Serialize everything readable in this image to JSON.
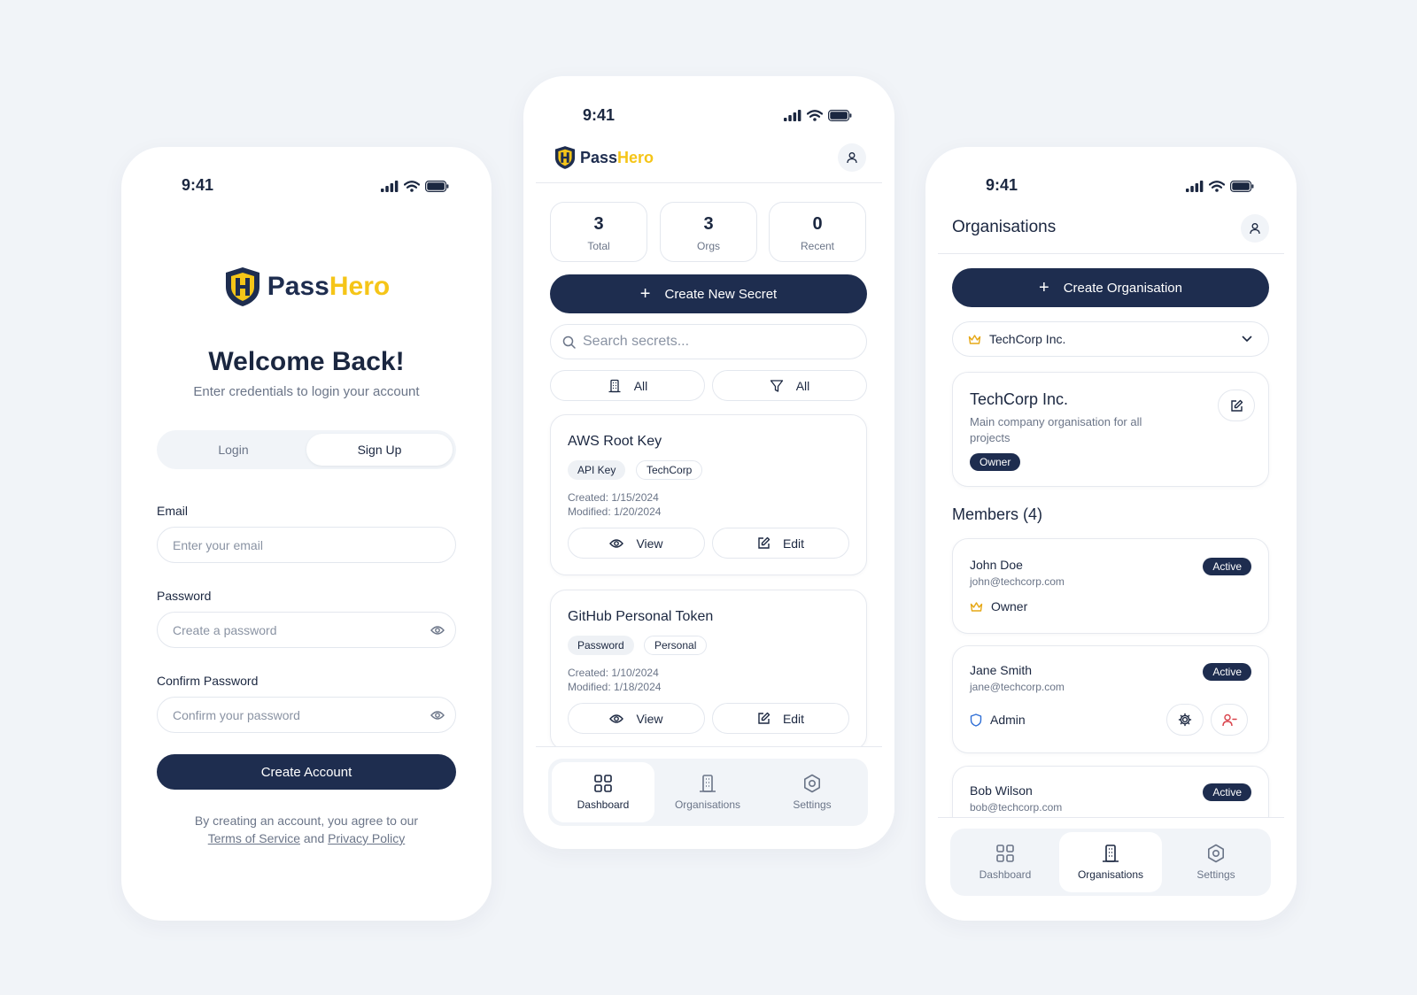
{
  "status_time": "9:41",
  "brand": {
    "pass": "Pass",
    "hero": "Hero"
  },
  "colors": {
    "navy": "#1e2d4f",
    "gold": "#f5c518",
    "muted": "#6b7588",
    "background": "#f1f4f8"
  },
  "login": {
    "heading": "Welcome Back!",
    "subheading": "Enter credentials to login your account",
    "tabs": [
      {
        "label": "Login",
        "active": false
      },
      {
        "label": "Sign Up",
        "active": true
      }
    ],
    "email": {
      "label": "Email",
      "placeholder": "Enter your email"
    },
    "password": {
      "label": "Password",
      "placeholder": "Create a password"
    },
    "confirm": {
      "label": "Confirm Password",
      "placeholder": "Confirm your password"
    },
    "submit_label": "Create Account",
    "legal": {
      "prefix": "By creating an account, you agree to our",
      "terms": "Terms of Service",
      "and": "and",
      "privacy": "Privacy Policy"
    }
  },
  "dashboard": {
    "stats": [
      {
        "value": "3",
        "label": "Total"
      },
      {
        "value": "3",
        "label": "Orgs"
      },
      {
        "value": "0",
        "label": "Recent"
      }
    ],
    "create_label": "Create New Secret",
    "search_placeholder": "Search secrets...",
    "filters": [
      {
        "icon": "building-icon",
        "label": "All"
      },
      {
        "icon": "filter-icon",
        "label": "All"
      }
    ],
    "secrets": [
      {
        "title": "AWS Root Key",
        "tags": [
          "API Key",
          "TechCorp"
        ],
        "created": "Created: 1/15/2024",
        "modified": "Modified: 1/20/2024",
        "view_label": "View",
        "edit_label": "Edit"
      },
      {
        "title": "GitHub Personal Token",
        "tags": [
          "Password",
          "Personal"
        ],
        "created": "Created: 1/10/2024",
        "modified": "Modified: 1/18/2024",
        "view_label": "View",
        "edit_label": "Edit"
      }
    ]
  },
  "nav": {
    "dashboard": "Dashboard",
    "organisations": "Organisations",
    "settings": "Settings"
  },
  "orgs": {
    "title": "Organisations",
    "create_label": "Create Organisation",
    "selected_org": "TechCorp Inc.",
    "org_card": {
      "name": "TechCorp Inc.",
      "description": "Main company organisation for all projects",
      "role_badge": "Owner"
    },
    "members_heading": "Members (4)",
    "members": [
      {
        "name": "John Doe",
        "email": "john@techcorp.com",
        "status": "Active",
        "role": "Owner",
        "role_icon": "crown-icon"
      },
      {
        "name": "Jane Smith",
        "email": "jane@techcorp.com",
        "status": "Active",
        "role": "Admin",
        "role_icon": "shield-icon"
      },
      {
        "name": "Bob Wilson",
        "email": "bob@techcorp.com",
        "status": "Active"
      }
    ]
  }
}
